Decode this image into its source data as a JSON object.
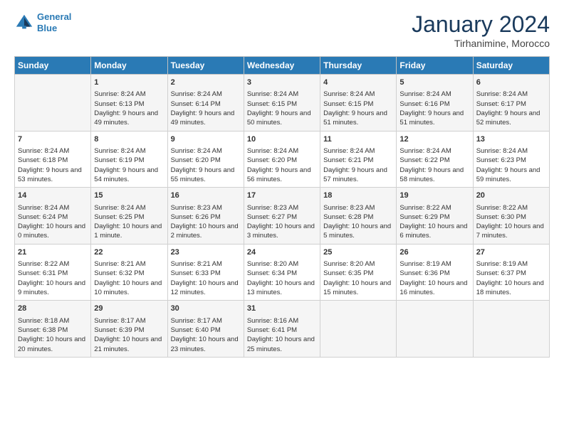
{
  "logo": {
    "line1": "General",
    "line2": "Blue"
  },
  "title": "January 2024",
  "subtitle": "Tirhanimine, Morocco",
  "header": {
    "days": [
      "Sunday",
      "Monday",
      "Tuesday",
      "Wednesday",
      "Thursday",
      "Friday",
      "Saturday"
    ]
  },
  "weeks": [
    {
      "cells": [
        {
          "day": "",
          "sunrise": "",
          "sunset": "",
          "daylight": ""
        },
        {
          "day": "1",
          "sunrise": "Sunrise: 8:24 AM",
          "sunset": "Sunset: 6:13 PM",
          "daylight": "Daylight: 9 hours and 49 minutes."
        },
        {
          "day": "2",
          "sunrise": "Sunrise: 8:24 AM",
          "sunset": "Sunset: 6:14 PM",
          "daylight": "Daylight: 9 hours and 49 minutes."
        },
        {
          "day": "3",
          "sunrise": "Sunrise: 8:24 AM",
          "sunset": "Sunset: 6:15 PM",
          "daylight": "Daylight: 9 hours and 50 minutes."
        },
        {
          "day": "4",
          "sunrise": "Sunrise: 8:24 AM",
          "sunset": "Sunset: 6:15 PM",
          "daylight": "Daylight: 9 hours and 51 minutes."
        },
        {
          "day": "5",
          "sunrise": "Sunrise: 8:24 AM",
          "sunset": "Sunset: 6:16 PM",
          "daylight": "Daylight: 9 hours and 51 minutes."
        },
        {
          "day": "6",
          "sunrise": "Sunrise: 8:24 AM",
          "sunset": "Sunset: 6:17 PM",
          "daylight": "Daylight: 9 hours and 52 minutes."
        }
      ]
    },
    {
      "cells": [
        {
          "day": "7",
          "sunrise": "Sunrise: 8:24 AM",
          "sunset": "Sunset: 6:18 PM",
          "daylight": "Daylight: 9 hours and 53 minutes."
        },
        {
          "day": "8",
          "sunrise": "Sunrise: 8:24 AM",
          "sunset": "Sunset: 6:19 PM",
          "daylight": "Daylight: 9 hours and 54 minutes."
        },
        {
          "day": "9",
          "sunrise": "Sunrise: 8:24 AM",
          "sunset": "Sunset: 6:20 PM",
          "daylight": "Daylight: 9 hours and 55 minutes."
        },
        {
          "day": "10",
          "sunrise": "Sunrise: 8:24 AM",
          "sunset": "Sunset: 6:20 PM",
          "daylight": "Daylight: 9 hours and 56 minutes."
        },
        {
          "day": "11",
          "sunrise": "Sunrise: 8:24 AM",
          "sunset": "Sunset: 6:21 PM",
          "daylight": "Daylight: 9 hours and 57 minutes."
        },
        {
          "day": "12",
          "sunrise": "Sunrise: 8:24 AM",
          "sunset": "Sunset: 6:22 PM",
          "daylight": "Daylight: 9 hours and 58 minutes."
        },
        {
          "day": "13",
          "sunrise": "Sunrise: 8:24 AM",
          "sunset": "Sunset: 6:23 PM",
          "daylight": "Daylight: 9 hours and 59 minutes."
        }
      ]
    },
    {
      "cells": [
        {
          "day": "14",
          "sunrise": "Sunrise: 8:24 AM",
          "sunset": "Sunset: 6:24 PM",
          "daylight": "Daylight: 10 hours and 0 minutes."
        },
        {
          "day": "15",
          "sunrise": "Sunrise: 8:24 AM",
          "sunset": "Sunset: 6:25 PM",
          "daylight": "Daylight: 10 hours and 1 minute."
        },
        {
          "day": "16",
          "sunrise": "Sunrise: 8:23 AM",
          "sunset": "Sunset: 6:26 PM",
          "daylight": "Daylight: 10 hours and 2 minutes."
        },
        {
          "day": "17",
          "sunrise": "Sunrise: 8:23 AM",
          "sunset": "Sunset: 6:27 PM",
          "daylight": "Daylight: 10 hours and 3 minutes."
        },
        {
          "day": "18",
          "sunrise": "Sunrise: 8:23 AM",
          "sunset": "Sunset: 6:28 PM",
          "daylight": "Daylight: 10 hours and 5 minutes."
        },
        {
          "day": "19",
          "sunrise": "Sunrise: 8:22 AM",
          "sunset": "Sunset: 6:29 PM",
          "daylight": "Daylight: 10 hours and 6 minutes."
        },
        {
          "day": "20",
          "sunrise": "Sunrise: 8:22 AM",
          "sunset": "Sunset: 6:30 PM",
          "daylight": "Daylight: 10 hours and 7 minutes."
        }
      ]
    },
    {
      "cells": [
        {
          "day": "21",
          "sunrise": "Sunrise: 8:22 AM",
          "sunset": "Sunset: 6:31 PM",
          "daylight": "Daylight: 10 hours and 9 minutes."
        },
        {
          "day": "22",
          "sunrise": "Sunrise: 8:21 AM",
          "sunset": "Sunset: 6:32 PM",
          "daylight": "Daylight: 10 hours and 10 minutes."
        },
        {
          "day": "23",
          "sunrise": "Sunrise: 8:21 AM",
          "sunset": "Sunset: 6:33 PM",
          "daylight": "Daylight: 10 hours and 12 minutes."
        },
        {
          "day": "24",
          "sunrise": "Sunrise: 8:20 AM",
          "sunset": "Sunset: 6:34 PM",
          "daylight": "Daylight: 10 hours and 13 minutes."
        },
        {
          "day": "25",
          "sunrise": "Sunrise: 8:20 AM",
          "sunset": "Sunset: 6:35 PM",
          "daylight": "Daylight: 10 hours and 15 minutes."
        },
        {
          "day": "26",
          "sunrise": "Sunrise: 8:19 AM",
          "sunset": "Sunset: 6:36 PM",
          "daylight": "Daylight: 10 hours and 16 minutes."
        },
        {
          "day": "27",
          "sunrise": "Sunrise: 8:19 AM",
          "sunset": "Sunset: 6:37 PM",
          "daylight": "Daylight: 10 hours and 18 minutes."
        }
      ]
    },
    {
      "cells": [
        {
          "day": "28",
          "sunrise": "Sunrise: 8:18 AM",
          "sunset": "Sunset: 6:38 PM",
          "daylight": "Daylight: 10 hours and 20 minutes."
        },
        {
          "day": "29",
          "sunrise": "Sunrise: 8:17 AM",
          "sunset": "Sunset: 6:39 PM",
          "daylight": "Daylight: 10 hours and 21 minutes."
        },
        {
          "day": "30",
          "sunrise": "Sunrise: 8:17 AM",
          "sunset": "Sunset: 6:40 PM",
          "daylight": "Daylight: 10 hours and 23 minutes."
        },
        {
          "day": "31",
          "sunrise": "Sunrise: 8:16 AM",
          "sunset": "Sunset: 6:41 PM",
          "daylight": "Daylight: 10 hours and 25 minutes."
        },
        {
          "day": "",
          "sunrise": "",
          "sunset": "",
          "daylight": ""
        },
        {
          "day": "",
          "sunrise": "",
          "sunset": "",
          "daylight": ""
        },
        {
          "day": "",
          "sunrise": "",
          "sunset": "",
          "daylight": ""
        }
      ]
    }
  ]
}
